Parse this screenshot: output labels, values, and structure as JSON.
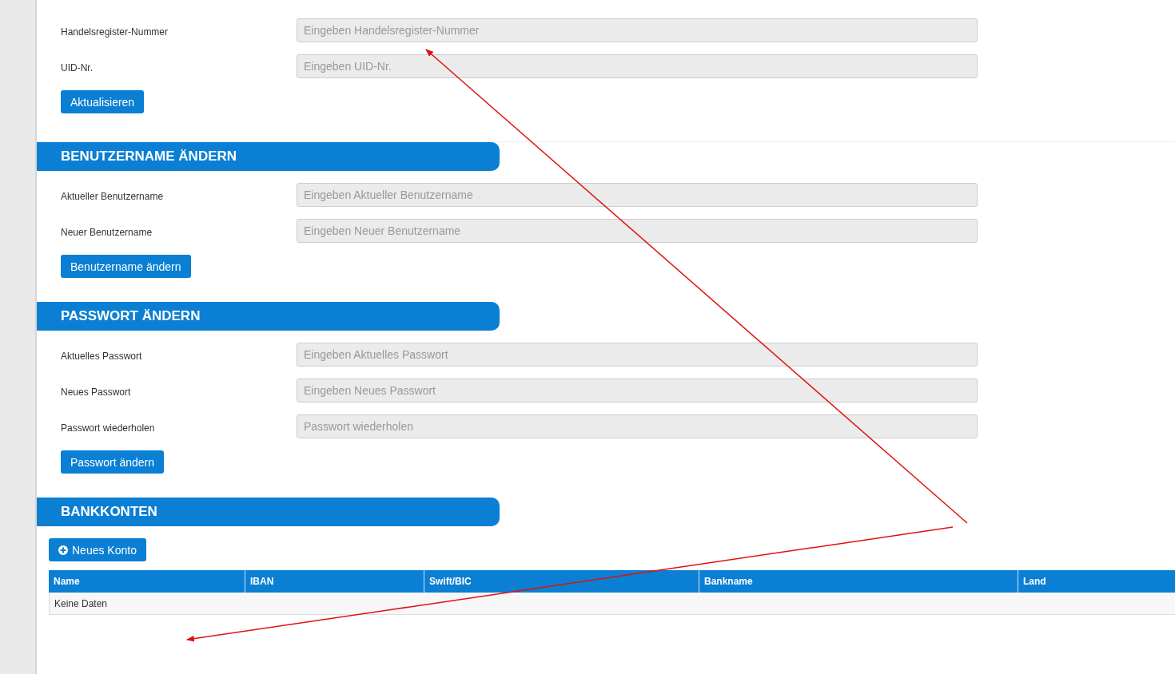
{
  "company_section": {
    "fields": [
      {
        "label": "Handelsregister-Nummer",
        "placeholder": "Eingeben Handelsregister-Nummer"
      },
      {
        "label": "UID-Nr.",
        "placeholder": "Eingeben UID-Nr."
      }
    ],
    "button": "Aktualisieren"
  },
  "sections": [
    {
      "title": "BENUTZERNAME ÄNDERN",
      "fields": [
        {
          "label": "Aktueller Benutzername",
          "placeholder": "Eingeben Aktueller Benutzername"
        },
        {
          "label": "Neuer Benutzername",
          "placeholder": "Eingeben Neuer Benutzername"
        }
      ],
      "button": "Benutzername ändern"
    },
    {
      "title": "PASSWORT ÄNDERN",
      "fields": [
        {
          "label": "Aktuelles Passwort",
          "placeholder": "Eingeben Aktuelles Passwort"
        },
        {
          "label": "Neues Passwort",
          "placeholder": "Eingeben Neues Passwort"
        },
        {
          "label": "Passwort wiederholen",
          "placeholder": "Passwort wiederholen"
        }
      ],
      "button": "Passwort ändern"
    }
  ],
  "bank_accounts": {
    "title": "BANKKONTEN",
    "add_button": "Neues Konto",
    "table": {
      "columns": [
        "Name",
        "IBAN",
        "Swift/BIC",
        "Bankname",
        "Land"
      ],
      "empty_text": "Keine Daten"
    }
  }
}
